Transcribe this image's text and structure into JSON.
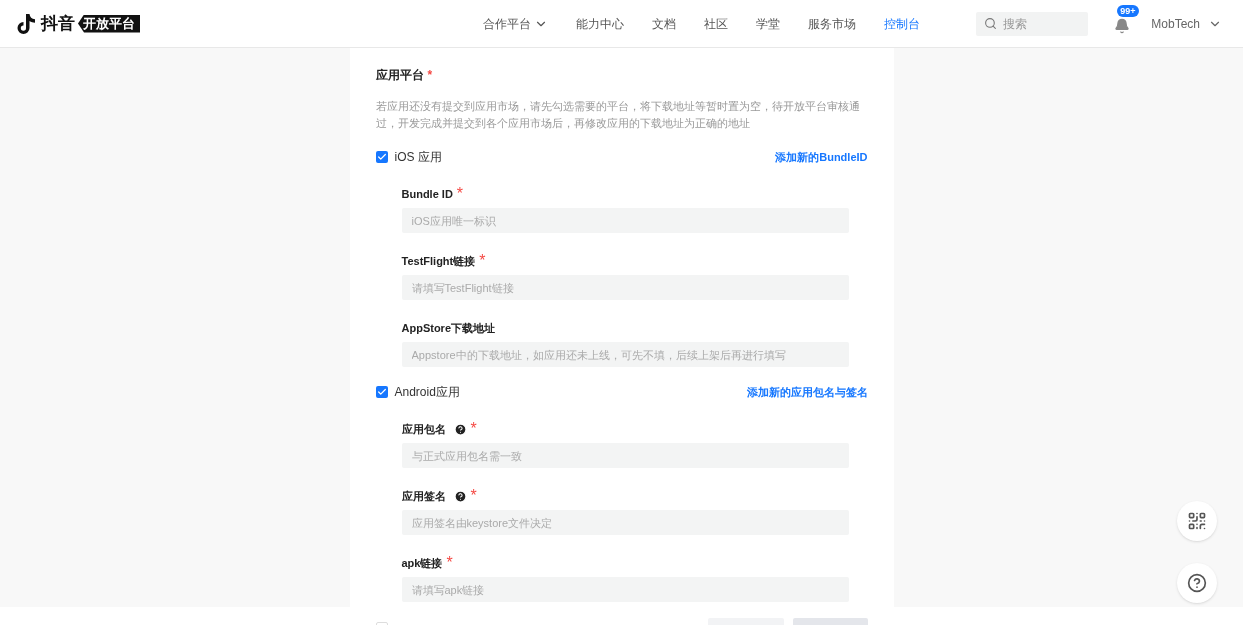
{
  "header": {
    "logo_text": "抖音",
    "logo_badge": "开放平台",
    "nav": [
      {
        "label": "合作平台",
        "dropdown": true,
        "selected": false
      },
      {
        "label": "能力中心",
        "dropdown": false,
        "selected": false
      },
      {
        "label": "文档",
        "dropdown": false,
        "selected": false
      },
      {
        "label": "社区",
        "dropdown": false,
        "selected": false
      },
      {
        "label": "学堂",
        "dropdown": false,
        "selected": false
      },
      {
        "label": "服务市场",
        "dropdown": false,
        "selected": false
      },
      {
        "label": "控制台",
        "dropdown": false,
        "selected": true
      }
    ],
    "search": {
      "placeholder": "搜索"
    },
    "notifications": {
      "badge": "99+"
    },
    "user": {
      "name": "MobTech"
    }
  },
  "form": {
    "title": "应用平台",
    "required_mark": "*",
    "description": "若应用还没有提交到应用市场，请先勾选需要的平台，将下载地址等暂时置为空，待开放平台审核通过，开发完成并提交到各个应用市场后，再修改应用的下载地址为正确的地址",
    "platforms": [
      {
        "label": "iOS 应用",
        "checked": true,
        "link": "添加新的BundleID",
        "fields": [
          {
            "label": "Bundle ID",
            "required_mark": "*",
            "help": false,
            "placeholder": "iOS应用唯一标识"
          },
          {
            "label": "TestFlight链接",
            "required_mark": "*",
            "help": false,
            "placeholder": "请填写TestFlight链接"
          },
          {
            "label": "AppStore下载地址",
            "help": false,
            "placeholder": "Appstore中的下载地址，如应用还未上线，可先不填，后续上架后再进行填写"
          }
        ]
      },
      {
        "label": "Android应用",
        "checked": true,
        "link": "添加新的应用包名与签名",
        "fields": [
          {
            "label": "应用包名",
            "required_mark": "*",
            "help": true,
            "placeholder": "与正式应用包名需一致"
          },
          {
            "label": "应用签名",
            "required_mark": "*",
            "help": true,
            "placeholder": "应用签名由keystore文件决定"
          },
          {
            "label": "apk链接",
            "required_mark": "*",
            "help": false,
            "placeholder": "请填写apk链接"
          }
        ]
      }
    ]
  },
  "footer": {
    "checked": false
  }
}
